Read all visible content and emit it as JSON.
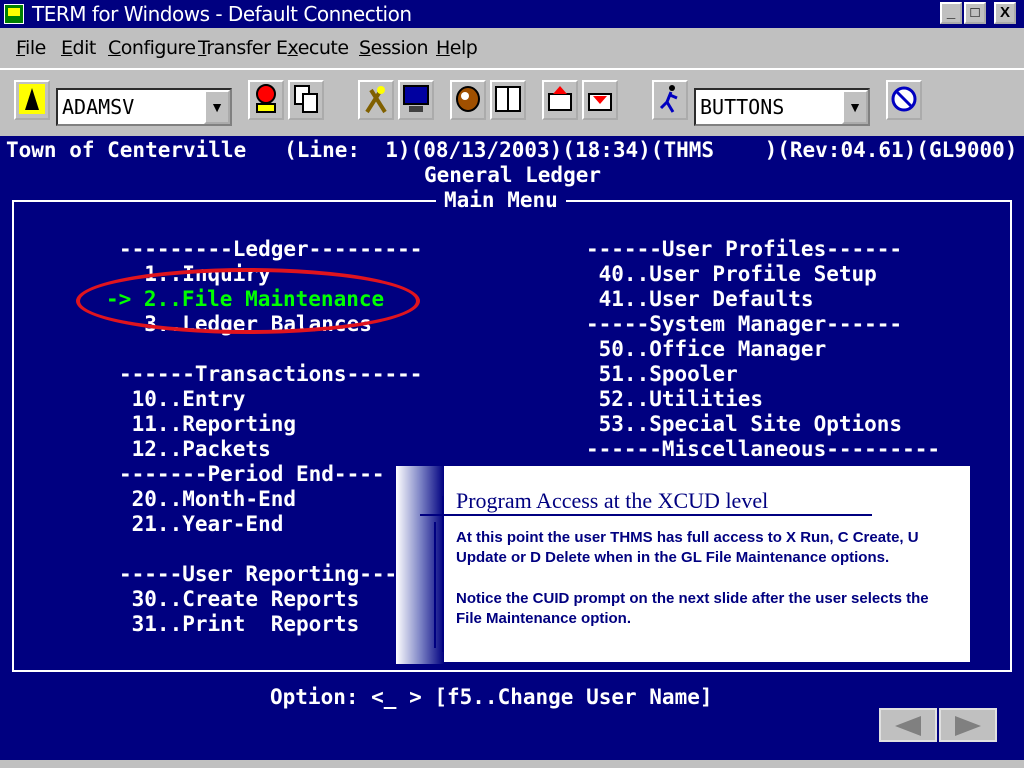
{
  "window": {
    "title": "TERM for Windows - Default Connection",
    "controls": [
      "_",
      "□",
      "X"
    ]
  },
  "menu": [
    {
      "label": "File",
      "accel": "F",
      "rest": "ile"
    },
    {
      "label": "Edit",
      "accel": "E",
      "rest": "dit"
    },
    {
      "label": "Configure",
      "accel": "C",
      "rest": "onfigure"
    },
    {
      "label": "Transfer",
      "accel": "T",
      "rest": "ransfer"
    },
    {
      "label": "Execute",
      "pre": "E",
      "accel": "x",
      "rest": "ecute"
    },
    {
      "label": "Session",
      "accel": "S",
      "rest": "ession"
    },
    {
      "label": "Help",
      "accel": "H",
      "rest": "elp"
    }
  ],
  "toolbar": {
    "connection_value": "ADAMSV",
    "buttons_value": "BUTTONS"
  },
  "terminal": {
    "status_line": "Town of Centerville   (Line:  1)(08/13/2003)(18:34)(THMS    )(Rev:04.61)(GL9000)",
    "heading": "General Ledger",
    "menu_title": "Main Menu",
    "left_column": [
      "---------Ledger---------",
      "  1..Inquiry",
      "  3..Ledger Balances",
      "",
      "------Transactions------",
      " 10..Entry",
      " 11..Reporting",
      " 12..Packets",
      "-------Period End----",
      " 20..Month-End",
      " 21..Year-End",
      "",
      "-----User Reporting---",
      " 30..Create Reports",
      " 31..Print  Reports"
    ],
    "selected_line": "-> 2..File Maintenance",
    "right_column": [
      "------User Profiles------",
      " 40..User Profile Setup",
      " 41..User Defaults",
      "-----System Manager------",
      " 50..Office Manager",
      " 51..Spooler",
      " 52..Utilities",
      " 53..Special Site Options",
      "------Miscellaneous---------"
    ],
    "option_prompt": "Option: <_ > [f5..Change User Name]"
  },
  "callout": {
    "title": "Program Access at the XCUD level",
    "paragraph1": "At this point the user THMS has full access to X Run, C Create, U Update or D Delete when in the GL File Maintenance options.",
    "paragraph2": "Notice the CUID prompt on the next slide after the user selects the File Maintenance option."
  },
  "colors": {
    "terminal_bg": "#000080",
    "selected_text": "#00ff00",
    "annotation": "#e0141e"
  }
}
